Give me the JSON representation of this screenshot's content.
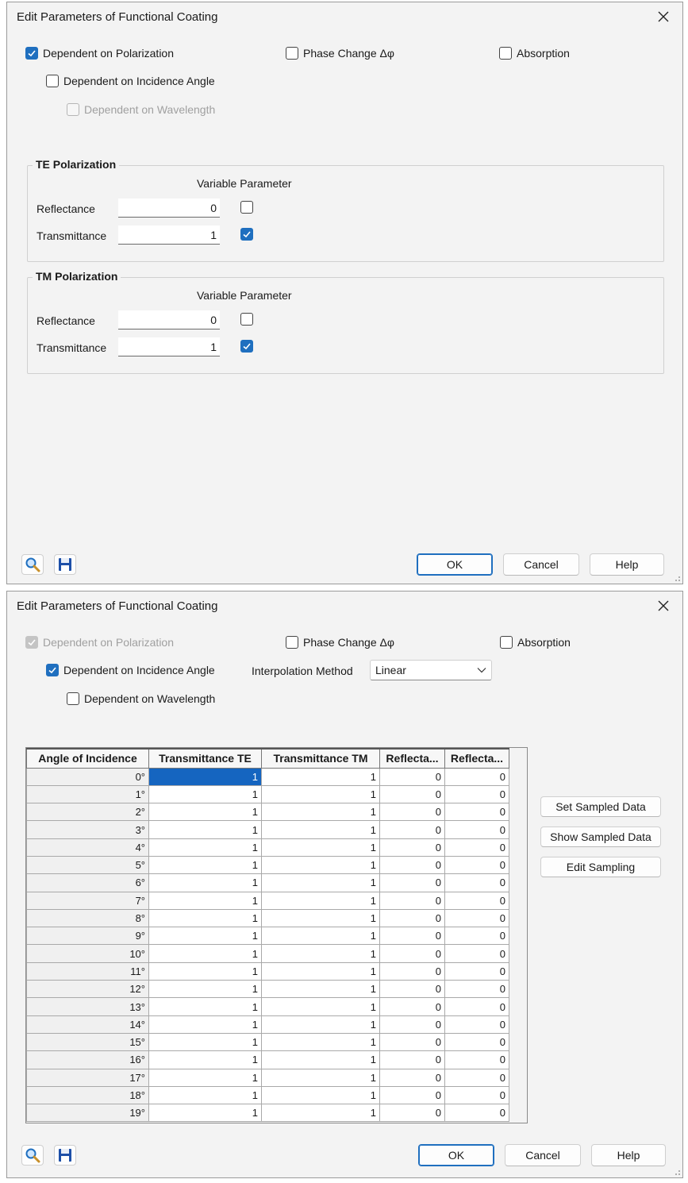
{
  "dialog1": {
    "title": "Edit Parameters of Functional Coating",
    "options": {
      "dependent_on_polarization": {
        "label": "Dependent on Polarization",
        "checked": true
      },
      "phase_change": {
        "label": "Phase Change Δφ",
        "checked": false
      },
      "absorption": {
        "label": "Absorption",
        "checked": false
      },
      "dependent_on_incidence_angle": {
        "label": "Dependent on Incidence Angle",
        "checked": false
      },
      "dependent_on_wavelength": {
        "label": "Dependent on Wavelength",
        "checked": false,
        "disabled": true
      }
    },
    "te_group": {
      "title": "TE Polarization",
      "variable_parameter_header": "Variable Parameter",
      "reflectance_label": "Reflectance",
      "reflectance_value": "0",
      "transmittance_label": "Transmittance",
      "transmittance_value": "1"
    },
    "tm_group": {
      "title": "TM Polarization",
      "variable_parameter_header": "Variable Parameter",
      "reflectance_label": "Reflectance",
      "reflectance_value": "0",
      "transmittance_label": "Transmittance",
      "transmittance_value": "1"
    },
    "buttons": {
      "ok": "OK",
      "cancel": "Cancel",
      "help": "Help"
    }
  },
  "dialog2": {
    "title": "Edit Parameters of Functional Coating",
    "options": {
      "dependent_on_polarization": {
        "label": "Dependent on Polarization",
        "checked": true,
        "disabled": true
      },
      "phase_change": {
        "label": "Phase Change Δφ",
        "checked": false
      },
      "absorption": {
        "label": "Absorption",
        "checked": false
      },
      "dependent_on_incidence_angle": {
        "label": "Dependent on Incidence Angle",
        "checked": true
      },
      "dependent_on_wavelength": {
        "label": "Dependent on Wavelength",
        "checked": false
      }
    },
    "interpolation": {
      "label": "Interpolation Method",
      "value": "Linear"
    },
    "table": {
      "columns": [
        "Angle of Incidence",
        "Transmittance TE",
        "Transmittance TM",
        "Reflecta...",
        "Reflecta..."
      ],
      "rows": [
        [
          "0°",
          "1",
          "1",
          "0",
          "0"
        ],
        [
          "1°",
          "1",
          "1",
          "0",
          "0"
        ],
        [
          "2°",
          "1",
          "1",
          "0",
          "0"
        ],
        [
          "3°",
          "1",
          "1",
          "0",
          "0"
        ],
        [
          "4°",
          "1",
          "1",
          "0",
          "0"
        ],
        [
          "5°",
          "1",
          "1",
          "0",
          "0"
        ],
        [
          "6°",
          "1",
          "1",
          "0",
          "0"
        ],
        [
          "7°",
          "1",
          "1",
          "0",
          "0"
        ],
        [
          "8°",
          "1",
          "1",
          "0",
          "0"
        ],
        [
          "9°",
          "1",
          "1",
          "0",
          "0"
        ],
        [
          "10°",
          "1",
          "1",
          "0",
          "0"
        ],
        [
          "11°",
          "1",
          "1",
          "0",
          "0"
        ],
        [
          "12°",
          "1",
          "1",
          "0",
          "0"
        ],
        [
          "13°",
          "1",
          "1",
          "0",
          "0"
        ],
        [
          "14°",
          "1",
          "1",
          "0",
          "0"
        ],
        [
          "15°",
          "1",
          "1",
          "0",
          "0"
        ],
        [
          "16°",
          "1",
          "1",
          "0",
          "0"
        ],
        [
          "17°",
          "1",
          "1",
          "0",
          "0"
        ],
        [
          "18°",
          "1",
          "1",
          "0",
          "0"
        ],
        [
          "19°",
          "1",
          "1",
          "0",
          "0"
        ]
      ]
    },
    "side_buttons": {
      "set_sampled": "Set Sampled Data",
      "show_sampled": "Show Sampled Data",
      "edit_sampling": "Edit Sampling"
    },
    "buttons": {
      "ok": "OK",
      "cancel": "Cancel",
      "help": "Help"
    }
  },
  "colors": {
    "accent": "#1f6fbf",
    "selection": "#1565c0",
    "dialog_bg": "#f3f3f3"
  },
  "icons": {
    "close": "close-icon",
    "zoom": "magnifier-icon",
    "save": "floppy-disk-icon",
    "dropdown": "chevron-down-icon"
  }
}
